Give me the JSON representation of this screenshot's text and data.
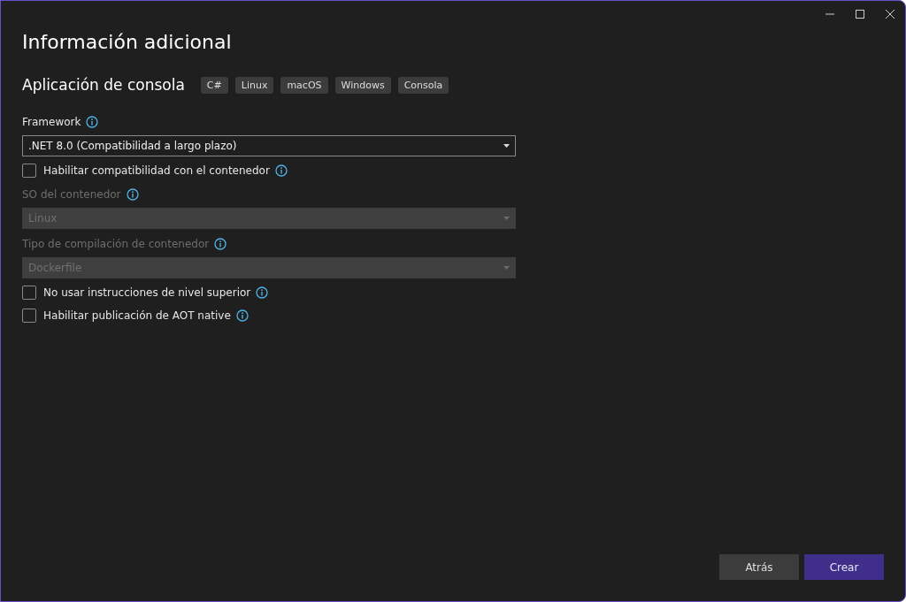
{
  "window": {
    "title": "Información adicional"
  },
  "project": {
    "name": "Aplicación de consola",
    "tags": [
      "C#",
      "Linux",
      "macOS",
      "Windows",
      "Consola"
    ]
  },
  "form": [
    {
      "kind": "label",
      "text": "Framework",
      "disabled": false
    },
    {
      "kind": "select",
      "value": ".NET 8.0 (Compatibilidad a largo plazo)",
      "disabled": false
    },
    {
      "kind": "checkbox",
      "label": "Habilitar compatibilidad con el contenedor",
      "checked": false
    },
    {
      "kind": "label",
      "text": "SO del contenedor",
      "disabled": true
    },
    {
      "kind": "select",
      "value": "Linux",
      "disabled": true
    },
    {
      "kind": "label",
      "text": "Tipo de compilación de contenedor",
      "disabled": true
    },
    {
      "kind": "select",
      "value": "Dockerfile",
      "disabled": true
    },
    {
      "kind": "checkbox",
      "label": "No usar instrucciones de nivel superior",
      "checked": false
    },
    {
      "kind": "checkbox",
      "label": "Habilitar publicación de AOT native",
      "checked": false
    }
  ],
  "buttons": [
    {
      "label": "Atrás",
      "primary": false
    },
    {
      "label": "Crear",
      "primary": true
    }
  ]
}
